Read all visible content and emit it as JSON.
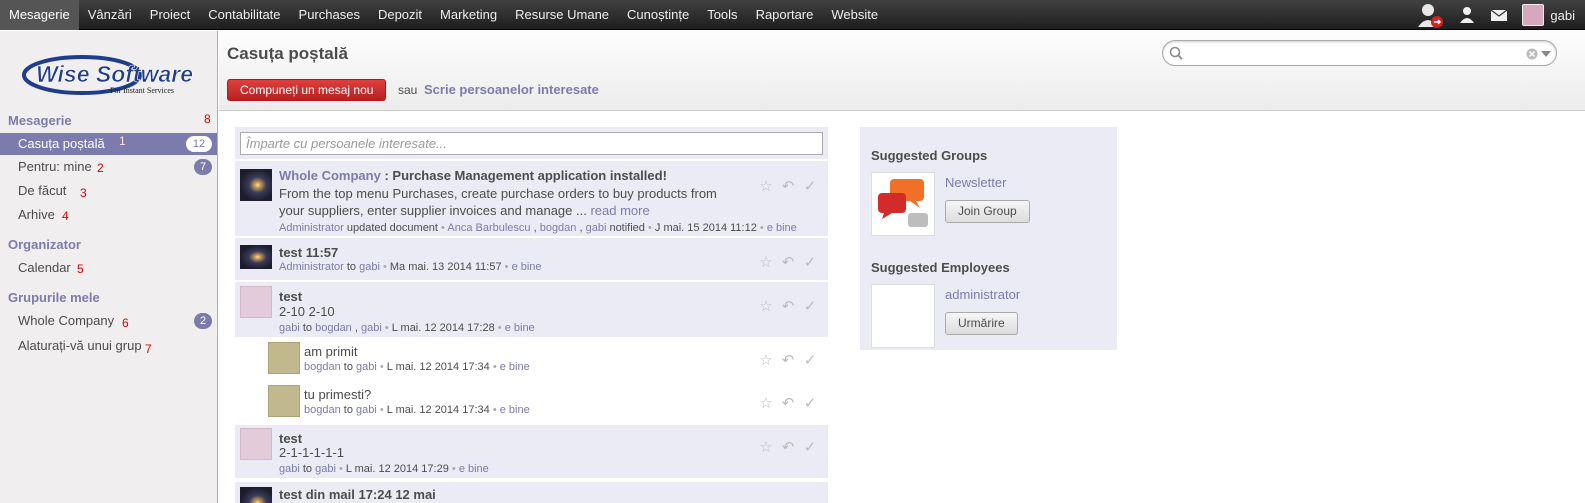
{
  "topmenu": {
    "items": [
      "Mesagerie",
      "Vânzări",
      "Proiect",
      "Contabilitate",
      "Purchases",
      "Depozit",
      "Marketing",
      "Resurse Umane",
      "Cunoștințe",
      "Tools",
      "Raportare",
      "Website"
    ],
    "active_index": 0,
    "user_name": "gabi"
  },
  "logo": {
    "brand": "Wise Software",
    "tagline": "For Instant Services"
  },
  "sidebar": {
    "sections": [
      {
        "title": "Mesagerie",
        "annotation": "8"
      },
      {
        "title": "Organizator"
      },
      {
        "title": "Grupurile mele"
      }
    ],
    "items": [
      {
        "label": "Casuța poștală",
        "badge": "12",
        "annotation": "1"
      },
      {
        "label": "Pentru: mine",
        "badge": "7",
        "annotation": "2"
      },
      {
        "label": "De făcut",
        "annotation": "3"
      },
      {
        "label": "Arhive",
        "annotation": "4"
      },
      {
        "label": "Calendar",
        "annotation": "5"
      },
      {
        "label": "Whole Company",
        "badge": "2",
        "annotation": "6"
      },
      {
        "label": "Alaturați-vă unui grup",
        "annotation": "7"
      }
    ]
  },
  "header": {
    "title": "Casuța poștală",
    "compose_label": "Compuneți un mesaj nou",
    "or_text": "sau",
    "write_link": "Scrie persoanelor interesate"
  },
  "thread": {
    "share_placeholder": "Împarte cu persoanele interesate...",
    "messages": [
      {
        "company": "Whole Company",
        "title": " : Purchase Management application installed!",
        "body1": "From the top menu Purchases, create purchase orders to buy products from",
        "body2": "your suppliers, enter supplier invoices and manage ... ",
        "more": "read more",
        "author": "Administrator",
        "action": " updated document ",
        "notified": "Anca Barbulescu",
        "notified2": "bogdan",
        "notified3": "gabi",
        "notified_text": " notified ",
        "date": "J mai. 15 2014 11:12",
        "vote": "e bine"
      },
      {
        "title": "test 11:57",
        "author": "Administrator",
        "to": "gabi",
        "date": "Ma mai. 13 2014 11:57",
        "vote": "e bine"
      },
      {
        "title": "test",
        "body": "2-10 2-10",
        "author": "gabi",
        "to1": "bogdan",
        "to2": "gabi",
        "date": "L mai. 12 2014 17:28",
        "vote": "e bine"
      },
      {
        "title": "am primit",
        "author": "bogdan",
        "to": "gabi",
        "date": "L mai. 12 2014 17:34",
        "vote": "e bine"
      },
      {
        "title": "tu primesti?",
        "author": "bogdan",
        "to": "gabi",
        "date": "L mai. 12 2014 17:34",
        "vote": "e bine"
      },
      {
        "title": "test",
        "body": "2-1-1-1-1-1",
        "author": "gabi",
        "to": "gabi",
        "date": "L mai. 12 2014 17:29",
        "vote": "e bine"
      },
      {
        "title": "test din mail 17:24 12 mai"
      }
    ],
    "to_word": " to "
  },
  "side_panel": {
    "groups_title": "Suggested Groups",
    "group_name": "Newsletter",
    "join_label": "Join Group",
    "employees_title": "Suggested Employees",
    "employee_name": "administrator",
    "follow_label": "Urmărire"
  },
  "colors": {
    "accent": "#7c7bad",
    "compose": "#c9302c",
    "topbar": "#2b2b2b"
  }
}
